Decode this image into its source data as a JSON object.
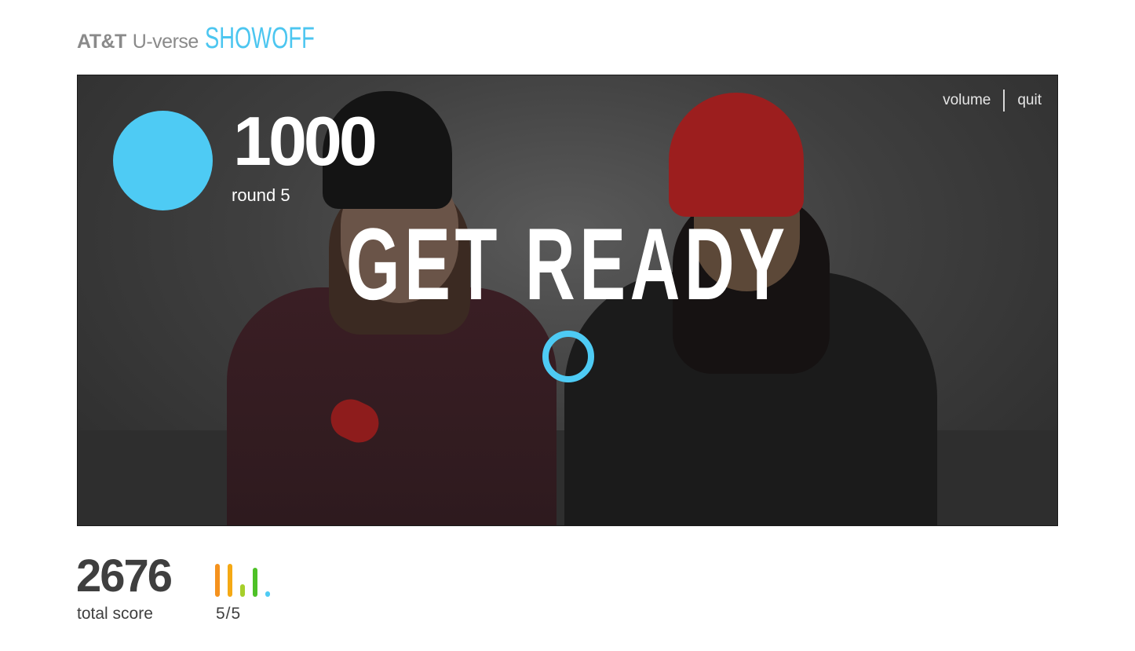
{
  "header": {
    "brand_att": "AT&T",
    "brand_uverse": "U-verse",
    "brand_showoff": "SHOWOFF"
  },
  "stage": {
    "volume_label": "volume",
    "quit_label": "quit",
    "round_points": "1000",
    "round_label": "round 5",
    "headline": "GET READY"
  },
  "footer": {
    "total_score": "2676",
    "total_score_label": "total score",
    "rounds_progress_label": "5/5",
    "round_bars": [
      {
        "round": 1,
        "level": 0.92,
        "color": "#f5921e"
      },
      {
        "round": 2,
        "level": 0.92,
        "color": "#f5a914"
      },
      {
        "round": 3,
        "level": 0.35,
        "color": "#a6cf2a"
      },
      {
        "round": 4,
        "level": 0.8,
        "color": "#4ec127"
      },
      {
        "round": 5,
        "level": 0.12,
        "color": "#4ecbf4"
      }
    ]
  },
  "colors": {
    "accent": "#4ecbf4",
    "logo_gray": "#8a8a8a",
    "text_dark": "#3f3f3f"
  },
  "icons": {
    "score_indicator": "filled-circle",
    "loading": "ring-spinner"
  }
}
